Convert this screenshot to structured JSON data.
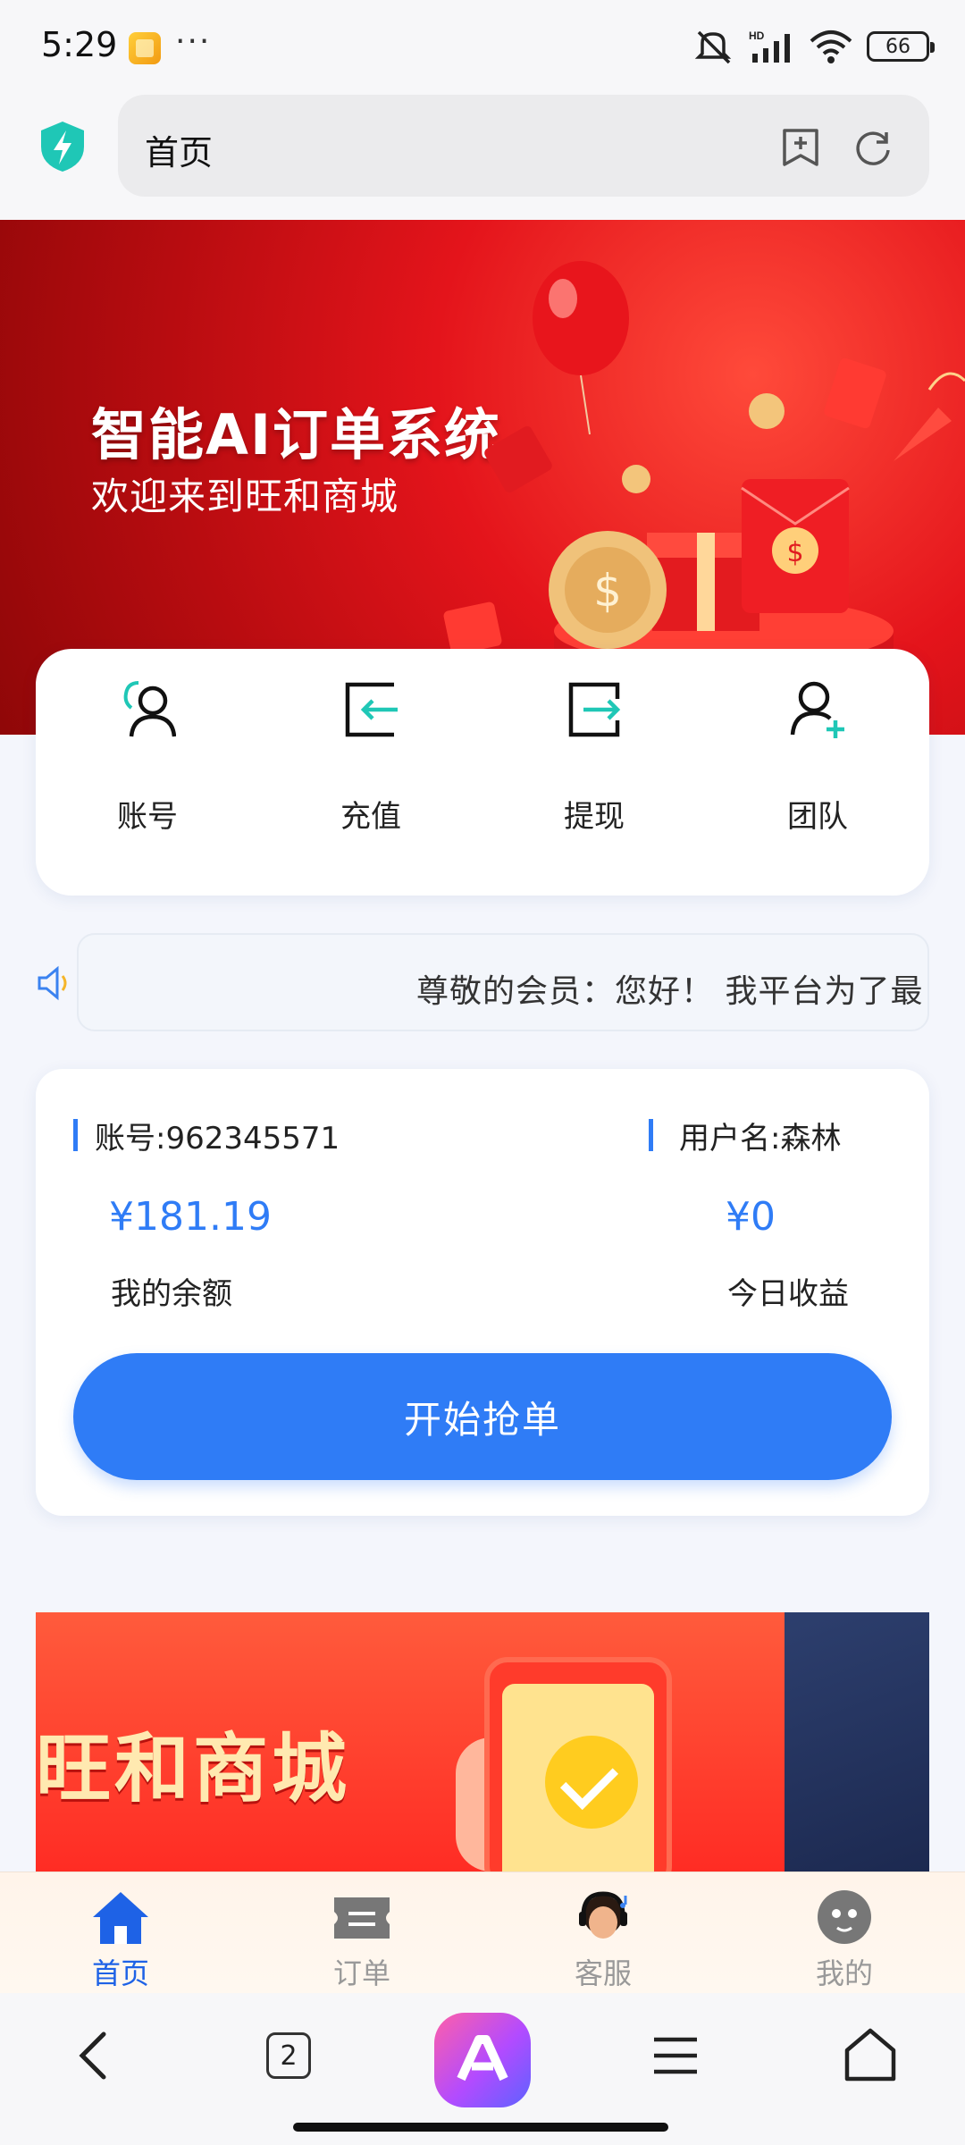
{
  "status_bar": {
    "time": "5:29",
    "more": "···",
    "network": "HD",
    "battery": "66"
  },
  "browser": {
    "url_text": "首页",
    "tab_count": "2"
  },
  "hero": {
    "title": "智能AI订单系统",
    "subtitle": "欢迎来到旺和商城"
  },
  "quick_actions": [
    {
      "label": "账号",
      "icon": "account-icon"
    },
    {
      "label": "充值",
      "icon": "recharge-icon"
    },
    {
      "label": "提现",
      "icon": "withdraw-icon"
    },
    {
      "label": "团队",
      "icon": "team-icon"
    }
  ],
  "notice": {
    "text": "尊敬的会员：您好！ 我平台为了最"
  },
  "account": {
    "account_label": "账号:962345571",
    "username_label": "用户名:森林",
    "balance_value": "¥181.19",
    "balance_label": "我的余额",
    "today_value": "¥0",
    "today_label": "今日收益",
    "grab_button": "开始抢单"
  },
  "promo": {
    "title": "旺和商城"
  },
  "tabbar": [
    {
      "label": "首页",
      "active": true
    },
    {
      "label": "订单",
      "active": false
    },
    {
      "label": "客服",
      "active": false
    },
    {
      "label": "我的",
      "active": false
    }
  ],
  "colors": {
    "primary": "#2f7cf6",
    "hero_red": "#e4141b",
    "accent_teal": "#1fc7b6",
    "tab_active": "#1e62e6"
  }
}
